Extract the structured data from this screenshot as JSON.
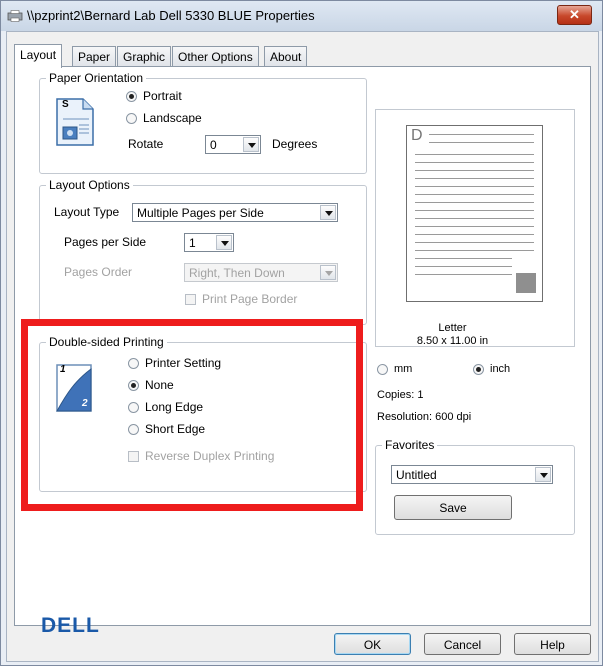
{
  "window": {
    "title": "\\\\pzprint2\\Bernard Lab Dell 5330 BLUE Properties",
    "close_label": "✕"
  },
  "tabs": [
    {
      "label": "Layout",
      "active": true
    },
    {
      "label": "Paper",
      "active": false
    },
    {
      "label": "Graphic",
      "active": false
    },
    {
      "label": "Other Options",
      "active": false
    },
    {
      "label": "About",
      "active": false
    }
  ],
  "orientation": {
    "title": "Paper Orientation",
    "portrait": "Portrait",
    "landscape": "Landscape",
    "rotate_label": "Rotate",
    "rotate_value": "0",
    "degrees_label": "Degrees",
    "selected": "Portrait",
    "icon_letter": "S"
  },
  "layout": {
    "title": "Layout Options",
    "type_label": "Layout Type",
    "type_value": "Multiple Pages per Side",
    "pages_label": "Pages per Side",
    "pages_value": "1",
    "order_label": "Pages Order",
    "order_value": "Right, Then Down",
    "border_label": "Print Page Border"
  },
  "duplex": {
    "title": "Double-sided Printing",
    "options": [
      "Printer Setting",
      "None",
      "Long Edge",
      "Short Edge"
    ],
    "selected": "None",
    "reverse_label": "Reverse Duplex Printing",
    "icon_1": "1",
    "icon_2": "2"
  },
  "preview": {
    "page_letter": "D",
    "paper_name": "Letter",
    "paper_size": "8.50 x 11.00 in",
    "unit_mm": "mm",
    "unit_inch": "inch",
    "unit_selected": "inch",
    "copies": "Copies: 1",
    "resolution": "Resolution: 600 dpi"
  },
  "favorites": {
    "title": "Favorites",
    "value": "Untitled",
    "save_label": "Save"
  },
  "brand": "DELL",
  "buttons": {
    "ok": "OK",
    "cancel": "Cancel",
    "help": "Help"
  },
  "colors": {
    "highlight": "#ee1d1d",
    "brand": "#1a59a8"
  }
}
